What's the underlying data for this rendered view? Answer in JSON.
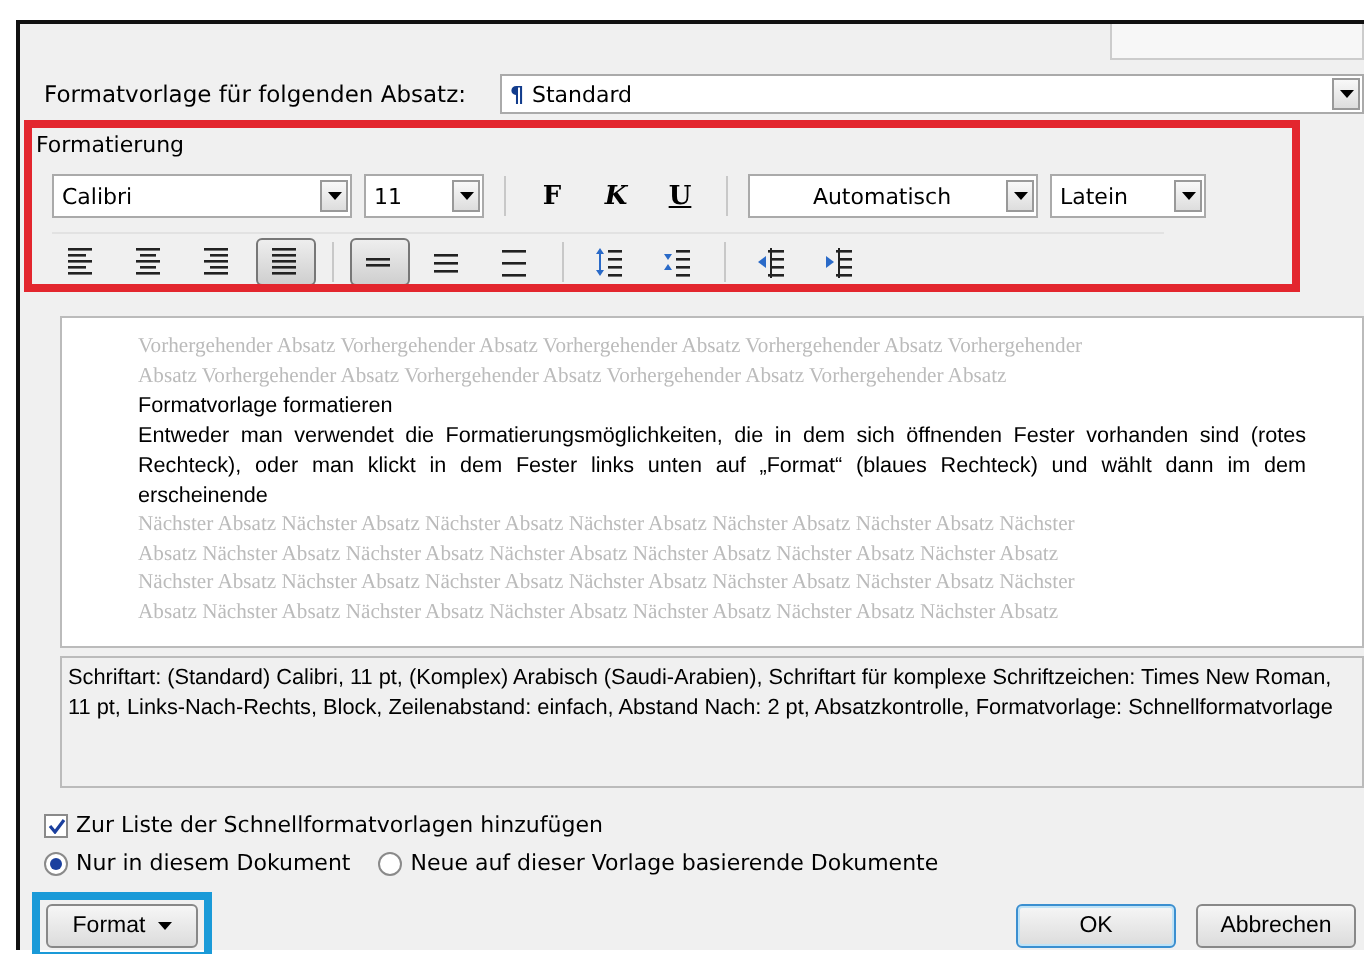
{
  "next_style": {
    "label": "Formatvorlage für folgenden Absatz:",
    "style_icon": "¶",
    "value": "Standard"
  },
  "formatting": {
    "label": "Formatierung",
    "font": "Calibri",
    "size": "11",
    "bold_label": "F",
    "italic_label": "K",
    "underline_label": "U",
    "font_color": "Automatisch",
    "script": "Latein",
    "align_buttons": [
      {
        "kind": "left",
        "selected": false
      },
      {
        "kind": "center",
        "selected": false
      },
      {
        "kind": "right",
        "selected": false
      },
      {
        "kind": "justify",
        "selected": true
      }
    ],
    "spacing_buttons": [
      {
        "kind": "single",
        "selected": true
      },
      {
        "kind": "onehalf",
        "selected": false
      },
      {
        "kind": "double",
        "selected": false
      }
    ],
    "para_buttons": [
      {
        "kind": "space-before"
      },
      {
        "kind": "space-after"
      }
    ],
    "indent_buttons": [
      {
        "kind": "decrease"
      },
      {
        "kind": "increase"
      }
    ]
  },
  "preview": {
    "previous_lines": [
      "Vorhergehender Absatz Vorhergehender Absatz Vorhergehender Absatz Vorhergehender Absatz Vorhergehender",
      "Absatz Vorhergehender Absatz Vorhergehender Absatz Vorhergehender Absatz Vorhergehender Absatz"
    ],
    "title": "Formatvorlage formatieren",
    "body": "Entweder man verwendet die Formatierungsmöglichkeiten, die in dem sich öffnenden Fester vorhanden sind (rotes Rechteck), oder man klickt in dem Fester links unten auf „Format“ (blaues Rechteck) und wählt dann im dem erscheinende",
    "next_lines": [
      "Nächster Absatz Nächster Absatz Nächster Absatz Nächster Absatz Nächster Absatz Nächster Absatz Nächster",
      "Absatz Nächster Absatz Nächster Absatz Nächster Absatz Nächster Absatz Nächster Absatz Nächster Absatz",
      "Nächster Absatz Nächster Absatz Nächster Absatz Nächster Absatz Nächster Absatz Nächster Absatz Nächster",
      "Absatz Nächster Absatz Nächster Absatz Nächster Absatz Nächster Absatz Nächster Absatz Nächster Absatz"
    ]
  },
  "description": "Schriftart: (Standard) Calibri, 11 pt, (Komplex) Arabisch (Saudi-Arabien), Schriftart für komplexe Schriftzeichen: Times New Roman, 11 pt, Links-Nach-Rechts, Block, Zeilenabstand:  einfach, Abstand Nach:  2 pt, Absatzkontrolle, Formatvorlage: Schnellformatvorlage",
  "add_to_quick_list": {
    "label": "Zur Liste der Schnellformatvorlagen hinzufügen",
    "checked": true
  },
  "scope": [
    {
      "label": "Nur in diesem Dokument",
      "selected": true
    },
    {
      "label": "Neue auf dieser Vorlage basierende Dokumente",
      "selected": false
    }
  ],
  "buttons": {
    "format": "Format",
    "ok": "OK",
    "cancel": "Abbrechen"
  }
}
